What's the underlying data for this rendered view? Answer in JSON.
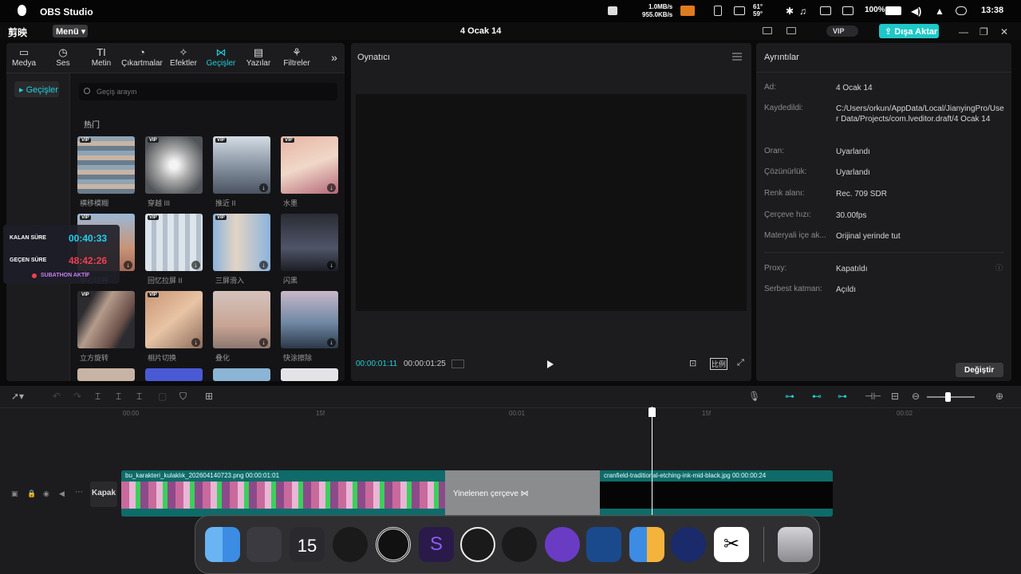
{
  "menubar": {
    "app_name": "OBS Studio",
    "net_up": "1.0MB/s",
    "net_down": "955.0KB/s",
    "temp": "61°",
    "temp2": "59°",
    "battery": "100%",
    "clock": "13:38"
  },
  "titlebar": {
    "logo": "剪映",
    "menu_label": "Menü",
    "doc_title": "4 Ocak 14",
    "vip_label": "VIP",
    "export_label": "Dışa Aktar"
  },
  "tabs": [
    {
      "label": "Medya",
      "icon": "media-icon"
    },
    {
      "label": "Ses",
      "icon": "audio-icon"
    },
    {
      "label": "Metin",
      "icon": "text-icon",
      "glyph": "TI"
    },
    {
      "label": "Çıkartmalar",
      "icon": "sticker-icon"
    },
    {
      "label": "Efektler",
      "icon": "effects-icon"
    },
    {
      "label": "Geçişler",
      "icon": "transition-icon",
      "active": true
    },
    {
      "label": "Yazılar",
      "icon": "captions-icon"
    },
    {
      "label": "Filtreler",
      "icon": "filter-icon"
    }
  ],
  "sidebar": {
    "active_item": "Geçişler"
  },
  "search": {
    "placeholder": "Geçiş arayın"
  },
  "section_label": "热门",
  "transitions": [
    {
      "label": "横移模糊",
      "vip": true,
      "download": false
    },
    {
      "label": "穿越 III",
      "vip": true,
      "download": false
    },
    {
      "label": "推近 II",
      "vip": true,
      "download": true
    },
    {
      "label": "水墨",
      "vip": true,
      "download": true
    },
    {
      "label": "中心切开",
      "vip": true,
      "download": true
    },
    {
      "label": "回忆拉屏 II",
      "vip": true,
      "download": true
    },
    {
      "label": "三屏滑入",
      "vip": true,
      "download": true
    },
    {
      "label": "闪黑",
      "vip": false,
      "download": true
    },
    {
      "label": "立方旋转",
      "vip": true,
      "download": false
    },
    {
      "label": "相片切换",
      "vip": true,
      "download": true
    },
    {
      "label": "叠化",
      "vip": false,
      "download": true
    },
    {
      "label": "快涂擦除",
      "vip": false,
      "download": true
    }
  ],
  "player": {
    "title": "Oynatıcı",
    "current_time": "00:00:01:11",
    "total_time": "00:00:01:25",
    "ratio_label": "比例"
  },
  "details": {
    "title": "Ayrıntılar",
    "rows": [
      {
        "key": "Ad:",
        "value": "4 Ocak 14"
      },
      {
        "key": "Kaydedildi:",
        "value": "C:/Users/orkun/AppData/Local/JianyingPro/User Data/Projects/com.lveditor.draft/4 Ocak 14"
      },
      {
        "key": "Oran:",
        "value": "Uyarlandı"
      },
      {
        "key": "Çözünürlük:",
        "value": "Uyarlandı"
      },
      {
        "key": "Renk alanı:",
        "value": "Rec. 709 SDR"
      },
      {
        "key": "Çerçeve hızı:",
        "value": "30.00fps"
      },
      {
        "key": "Materyali içe ak...",
        "value": "Orijinal yerinde tut"
      },
      {
        "key": "Proxy:",
        "value": "Kapatıldı"
      },
      {
        "key": "Serbest katman:",
        "value": "Açıldı"
      }
    ],
    "change_button": "Değiştir"
  },
  "timeline": {
    "ruler": [
      "00:00",
      "15f",
      "00:01",
      "15f",
      "00:02"
    ],
    "cover_label": "Kapak",
    "clip1_name": "bu_karakteri_kulaklık_20260414072​3.png  00:00:01:01",
    "clip2_name": "Yinelenen çerçeve ⋈",
    "clip3_name": "cranfield-traditional-etching-ink-mid-black.jpg  00:00:00:24"
  },
  "timer": {
    "remaining_label": "KALAN SÜRE",
    "remaining_value": "00:40:33",
    "elapsed_label": "GEÇEN SÜRE",
    "elapsed_value": "48:42:26",
    "status": "SUBATHON AKTİF"
  },
  "dock": {
    "calendar_day": "15",
    "apps": [
      "finder-icon",
      "launchpad-icon",
      "calendar-icon",
      "clock-icon",
      "target-icon",
      "affinity-icon",
      "obs-icon",
      "steam-icon",
      "discord-icon",
      "remote-desktop-icon",
      "windows-icon",
      "network-icon",
      "capcut-icon",
      "trash-icon"
    ]
  },
  "colors": {
    "accent": "#20d0d8",
    "export": "#1fc8c8",
    "clip": "#0e6b69"
  }
}
